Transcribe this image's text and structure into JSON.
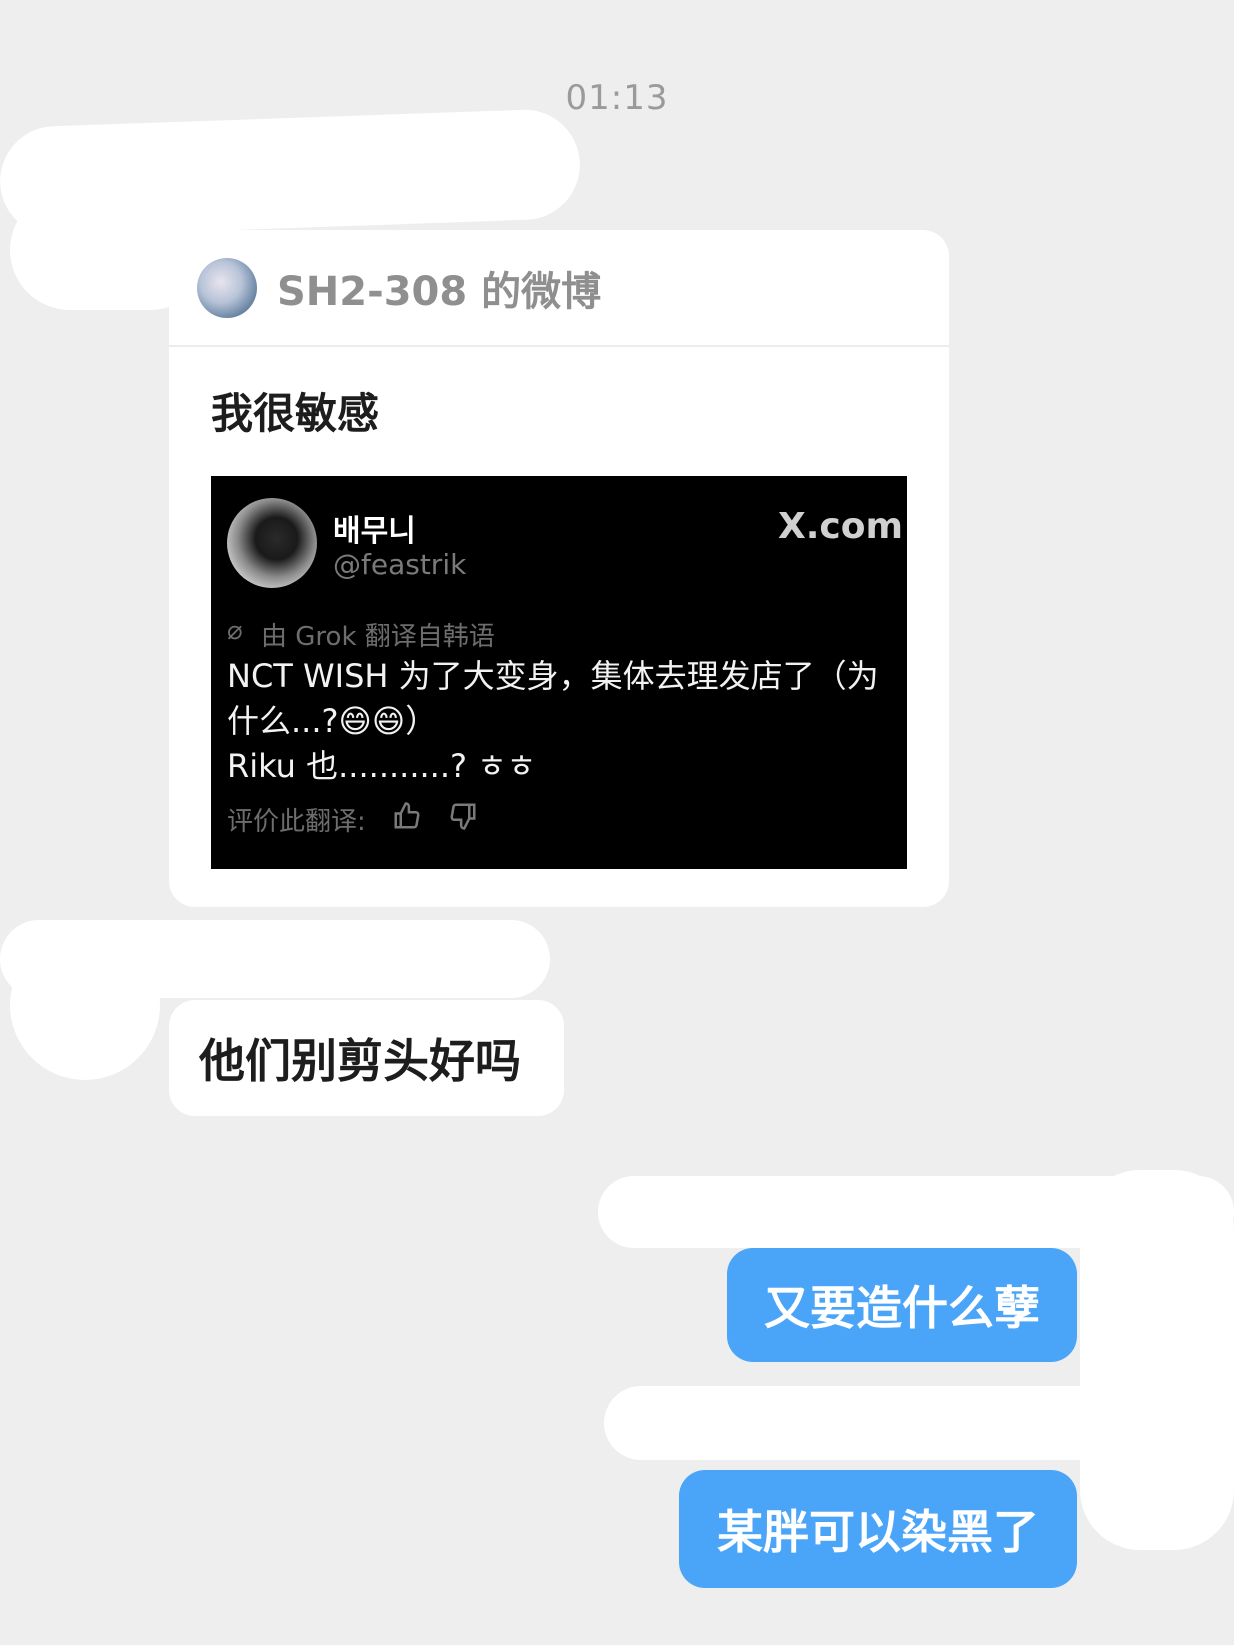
{
  "timestamp": "01:13",
  "shared_post": {
    "source": "SH2-308 的微博",
    "text": "我很敏感",
    "embedded_tweet": {
      "display_name": "배무니",
      "handle": "@feastrik",
      "brand": "X.com",
      "translation_note": "由 Grok 翻译自韩语",
      "body_lines": [
        "NCT WISH 为了大变身，集体去理发店了（为",
        "什么...?😄😄）",
        "Riku 也...........? ㅎㅎ"
      ],
      "rate_label": "评价此翻译:",
      "icons": [
        "thumbs-up-icon",
        "thumbs-down-icon",
        "translate-icon"
      ]
    }
  },
  "messages": {
    "incoming": "他们别剪头好吗",
    "outgoing": [
      "又要造什么孽",
      "某胖可以染黑了"
    ]
  },
  "colors": {
    "background": "#eeeeee",
    "outgoing_bubble": "#4aa4f7",
    "incoming_bubble": "#ffffff"
  }
}
